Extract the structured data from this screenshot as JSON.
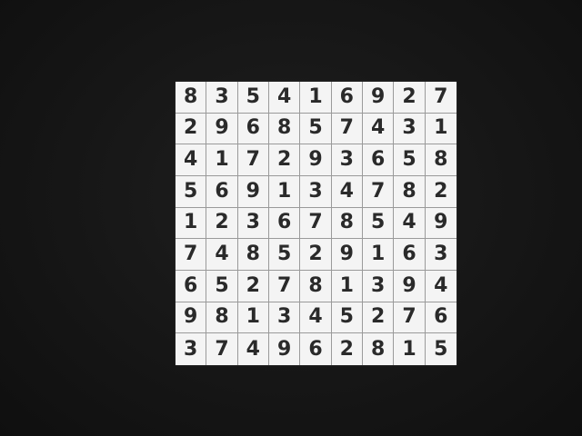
{
  "grid": [
    [
      "8",
      "3",
      "5",
      "4",
      "1",
      "6",
      "9",
      "2",
      "7"
    ],
    [
      "2",
      "9",
      "6",
      "8",
      "5",
      "7",
      "4",
      "3",
      "1"
    ],
    [
      "4",
      "1",
      "7",
      "2",
      "9",
      "3",
      "6",
      "5",
      "8"
    ],
    [
      "5",
      "6",
      "9",
      "1",
      "3",
      "4",
      "7",
      "8",
      "2"
    ],
    [
      "1",
      "2",
      "3",
      "6",
      "7",
      "8",
      "5",
      "4",
      "9"
    ],
    [
      "7",
      "4",
      "8",
      "5",
      "2",
      "9",
      "1",
      "6",
      "3"
    ],
    [
      "6",
      "5",
      "2",
      "7",
      "8",
      "1",
      "3",
      "9",
      "4"
    ],
    [
      "9",
      "8",
      "1",
      "3",
      "4",
      "5",
      "2",
      "7",
      "6"
    ],
    [
      "3",
      "7",
      "4",
      "9",
      "6",
      "2",
      "8",
      "1",
      "5"
    ]
  ],
  "colors": {
    "background": "#151515",
    "paper": "#f4f4f4",
    "digit": "#2a2a2a",
    "grid_line": "#9a9a9a"
  }
}
